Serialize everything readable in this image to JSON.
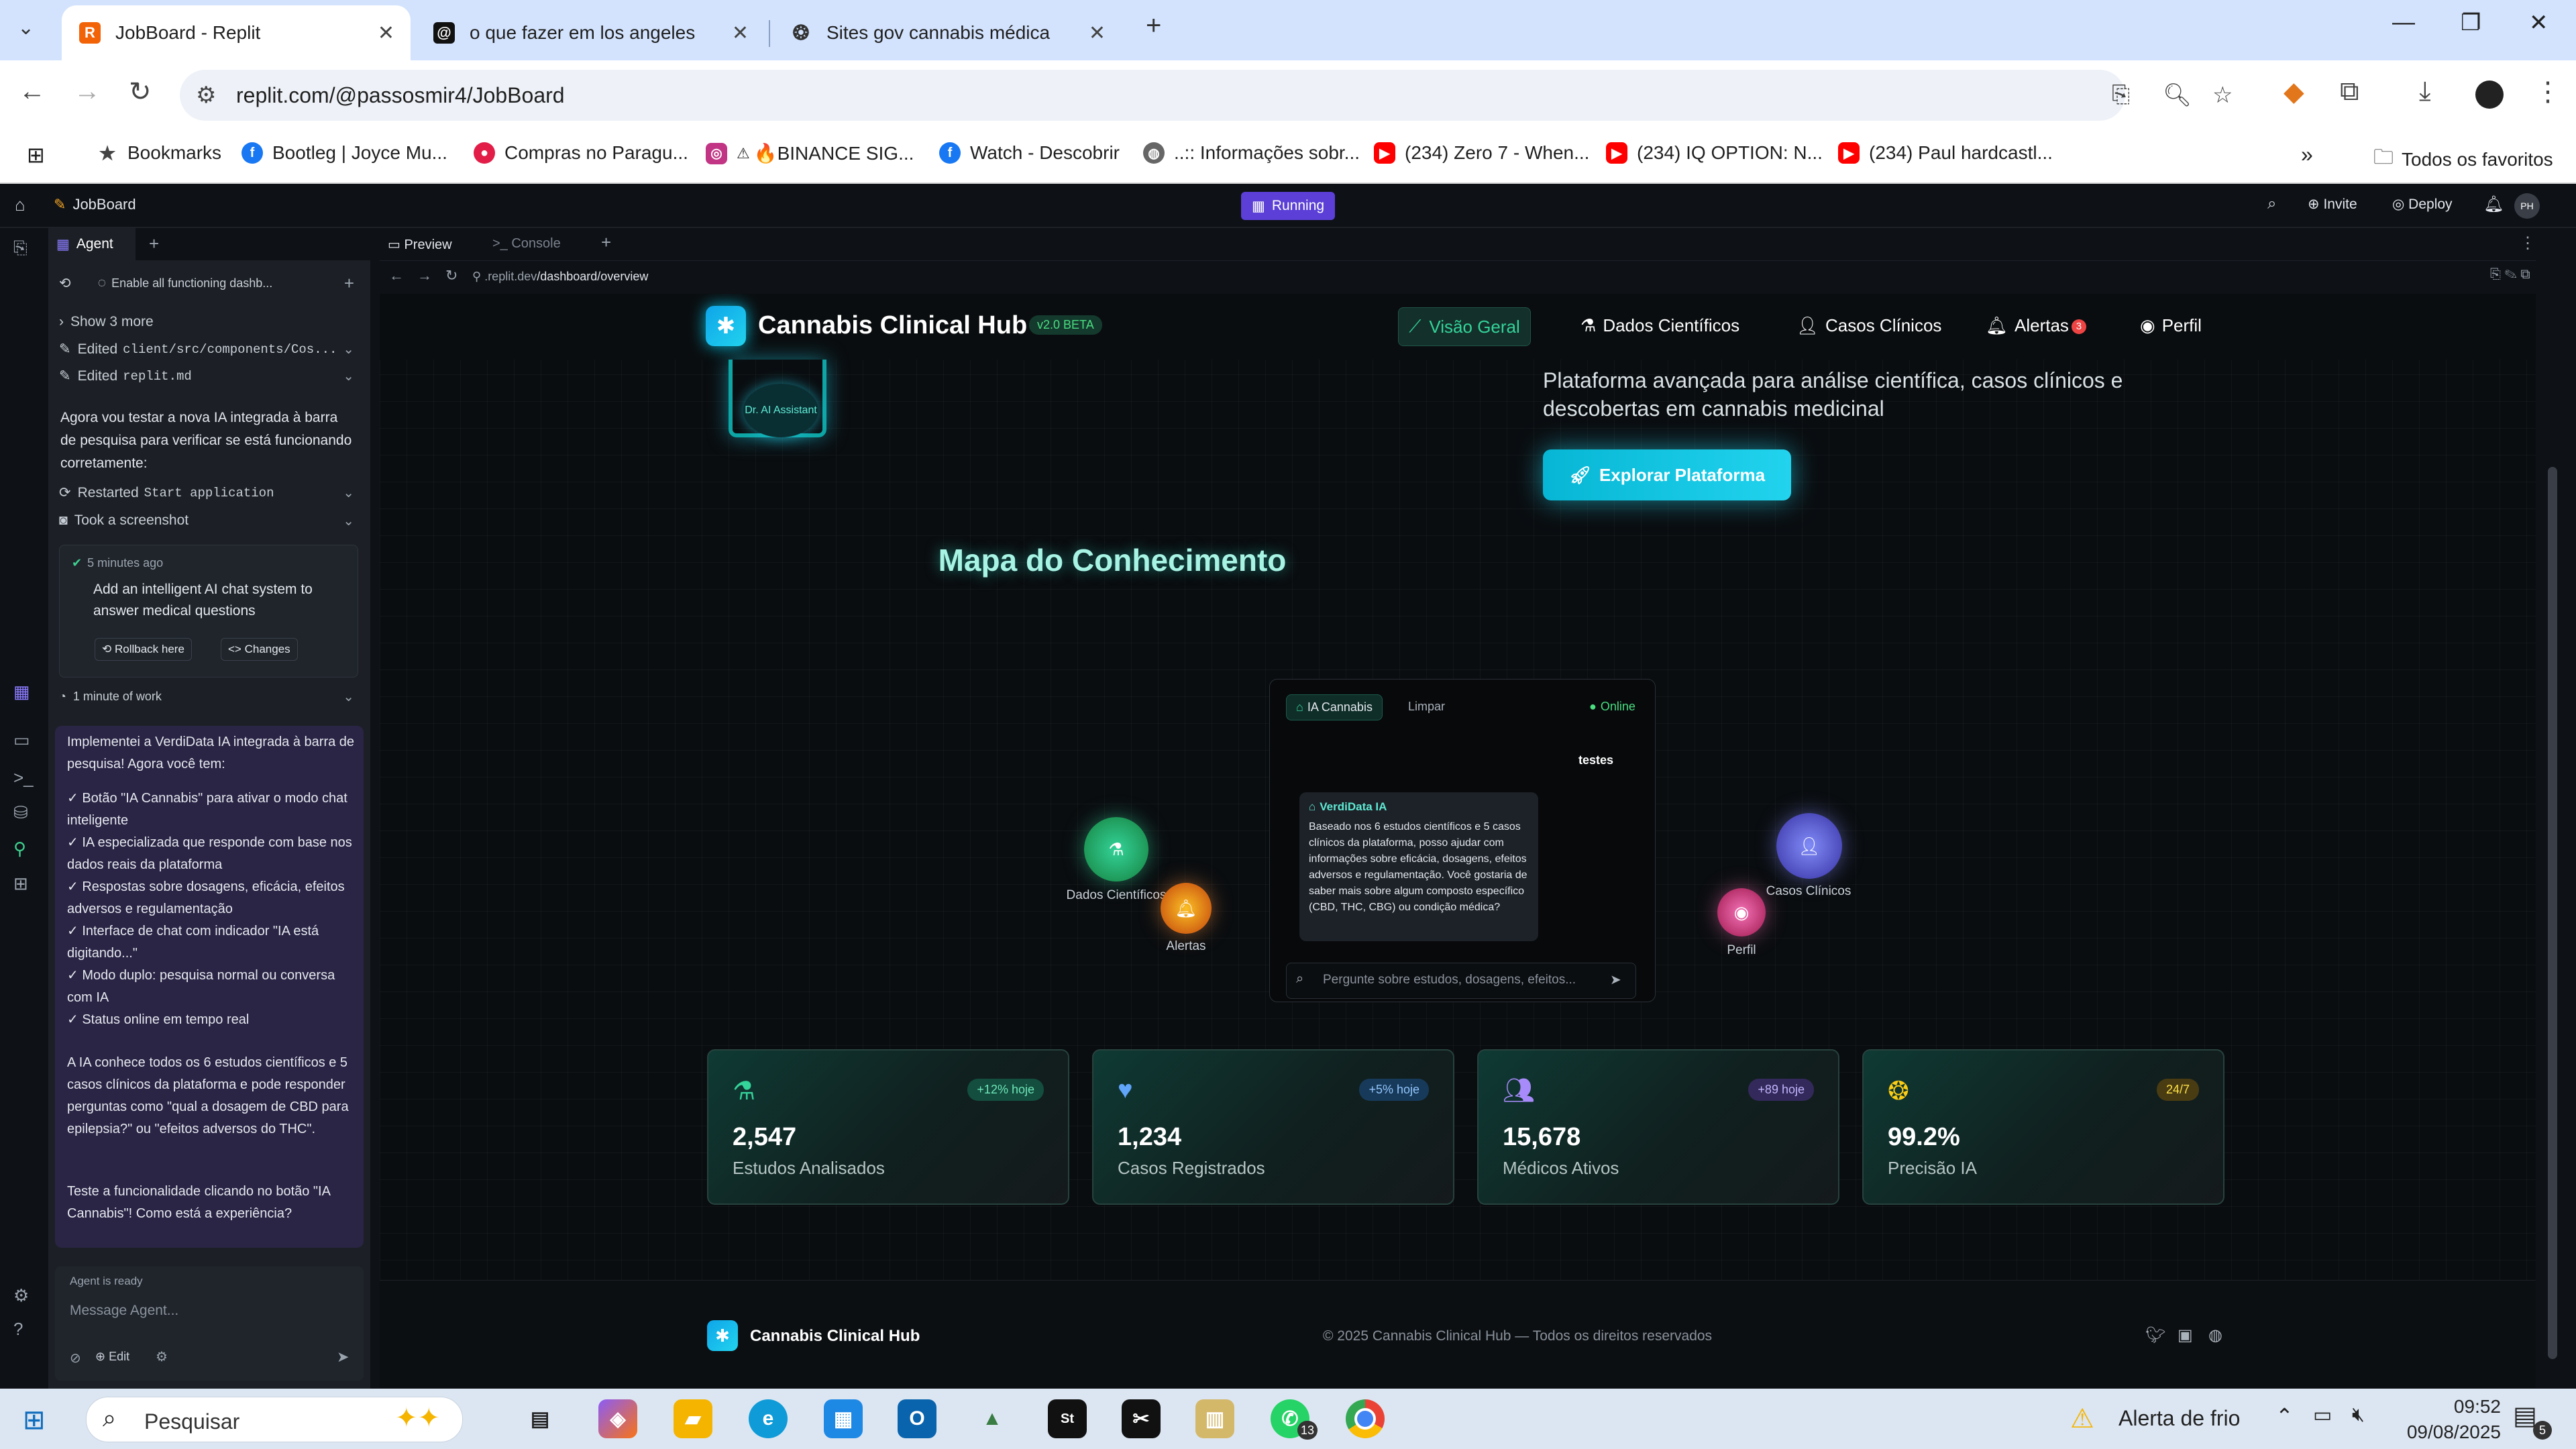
{
  "browser": {
    "tabs": [
      {
        "title": "JobBoard - Replit",
        "active": true
      },
      {
        "title": "o que fazer em los angeles",
        "active": false
      },
      {
        "title": "Sites gov cannabis médica",
        "active": false
      }
    ],
    "url": "replit.com/@passosmir4/JobBoard",
    "bookmarks": [
      "Bookmarks",
      "Bootleg | Joyce Mu...",
      "Compras no Paragu...",
      "🔥BINANCE SIG...",
      "Watch - Descobrir",
      "..:: Informações sobr...",
      "(234) Zero 7 - When...",
      "(234) IQ OPTION: N...",
      "(234) Paul hardcastl..."
    ],
    "favorites_label": "Todos os favoritos"
  },
  "replit": {
    "project": "JobBoard",
    "status": "Running",
    "invite": "Invite",
    "deploy": "Deploy",
    "avatar": "PH"
  },
  "agent": {
    "tab": "Agent",
    "thread_title": "Enable all functioning dashb...",
    "show_more": "Show 3 more",
    "edited_1_prefix": "Edited",
    "edited_1_file": "client/src/components/Cos...",
    "edited_2_prefix": "Edited",
    "edited_2_file": "replit.md",
    "msg_test": "Agora vou testar a nova IA integrada à barra de pesquisa para verificar se está funcionando corretamente:",
    "restarted_prefix": "Restarted",
    "restarted_target": "Start application",
    "screenshot": "Took a screenshot",
    "checkpoint_time": "5 minutes ago",
    "checkpoint_title": "Add an intelligent AI chat system to answer medical questions",
    "rollback": "Rollback here",
    "changes": "Changes",
    "work": "1 minute of work",
    "summary_intro": "Implementei a VerdiData IA integrada à barra de pesquisa! Agora você tem:",
    "summary_items": [
      "✓ Botão \"IA Cannabis\" para ativar o modo chat inteligente",
      "✓ IA especializada que responde com base nos dados reais da plataforma",
      "✓ Respostas sobre dosagens, eficácia, efeitos adversos e regulamentação",
      "✓ Interface de chat com indicador \"IA está digitando...\"",
      "✓ Modo duplo: pesquisa normal ou conversa com IA",
      "✓ Status online em tempo real"
    ],
    "summary_p2": "A IA conhece todos os 6 estudos científicos e 5 casos clínicos da plataforma e pode responder perguntas como \"qual a dosagem de CBD para epilepsia?\" ou \"efeitos adversos do THC\".",
    "summary_p3": "Teste a funcionalidade clicando no botão \"IA Cannabis\"! Como está a experiência?",
    "ready": "Agent is ready",
    "input_placeholder": "Message Agent...",
    "edit": "Edit"
  },
  "preview": {
    "tab_preview": "Preview",
    "tab_console": "Console",
    "url_domain": ".replit.dev",
    "url_path": "/dashboard/overview"
  },
  "app": {
    "brand": "Cannabis Clinical Hub",
    "version": "v2.0 BETA",
    "nav": [
      {
        "label": "Visão Geral",
        "active": true
      },
      {
        "label": "Dados Científicos",
        "active": false
      },
      {
        "label": "Casos Clínicos",
        "active": false
      },
      {
        "label": "Alertas",
        "active": false,
        "badge": "3"
      },
      {
        "label": "Perfil",
        "active": false
      }
    ],
    "assistant_label": "Dr. AI Assistant",
    "hero_text": "Plataforma avançada para análise científica, casos clínicos e descobertas em cannabis medicinal",
    "cta": "Explorar Plataforma",
    "map_title": "Mapa do Conhecimento",
    "chat": {
      "ia_button": "IA Cannabis",
      "clear": "Limpar",
      "online": "Online",
      "user_msg": "testes",
      "bot_name": "VerdiData IA",
      "bot_msg": "Baseado nos 6 estudos científicos e 5 casos clínicos da plataforma, posso ajudar com informações sobre eficácia, dosagens, efeitos adversos e regulamentação. Você gostaria de saber mais sobre algum composto específico (CBD, THC, CBG) ou condição médica?",
      "placeholder": "Pergunte sobre estudos, dosagens, efeitos..."
    },
    "nodes": {
      "dados": "Dados Científicos",
      "alertas": "Alertas",
      "casos": "Casos Clínicos",
      "perfil": "Perfil"
    },
    "stats": [
      {
        "value": "2,547",
        "label": "Estudos Analisados",
        "badge": "+12% hoje",
        "icon": "flask-icon",
        "color": "#34d399"
      },
      {
        "value": "1,234",
        "label": "Casos Registrados",
        "badge": "+5% hoje",
        "icon": "heartbeat-icon",
        "color": "#60a5fa"
      },
      {
        "value": "15,678",
        "label": "Médicos Ativos",
        "badge": "+89 hoje",
        "icon": "users-icon",
        "color": "#a78bfa"
      },
      {
        "value": "99.2%",
        "label": "Precisão IA",
        "badge": "24/7",
        "icon": "brain-icon",
        "color": "#facc15"
      }
    ],
    "footer_brand": "Cannabis Clinical Hub",
    "footer_copy": "© 2025 Cannabis Clinical Hub — Todos os direitos reservados"
  },
  "taskbar": {
    "search": "Pesquisar",
    "weather": "Alerta de frio",
    "time": "09:52",
    "date": "09/08/2025",
    "whatsapp_badge": "13",
    "notif_badge": "5"
  }
}
